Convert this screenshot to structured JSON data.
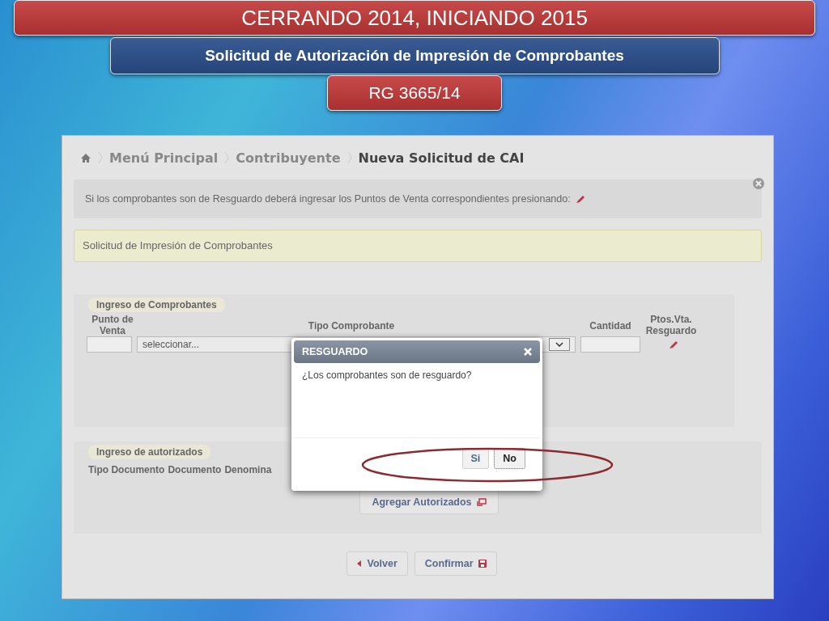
{
  "slide": {
    "title": "CERRANDO 2014, INICIANDO 2015",
    "subtitle": "Solicitud de Autorización de Impresión de Comprobantes",
    "tag": "RG 3665/14"
  },
  "breadcrumb": [
    {
      "label": "Menú Principal",
      "current": false
    },
    {
      "label": "Contribuyente",
      "current": false
    },
    {
      "label": "Nueva Solicitud de CAI",
      "current": true
    }
  ],
  "notice": {
    "text": "Si los comprobantes son de Resguardo deberá ingresar los Puntos de Venta correspondientes presionando:"
  },
  "section_title": "Solicitud de Impresión de Comprobantes",
  "comprobantes": {
    "legend": "Ingreso de Comprobantes",
    "columns": [
      {
        "label": "Punto de Venta"
      },
      {
        "label": "Tipo Comprobante"
      },
      {
        "label": "Cantidad"
      },
      {
        "label": "Ptos.Vta. Resguardo"
      }
    ],
    "select_value": "seleccionar..."
  },
  "autorizados": {
    "legend": "Ingreso de autorizados",
    "columns": [
      "Tipo Documento",
      "Documento",
      "Denomina"
    ],
    "add_button": "Agregar Autorizados"
  },
  "actions": [
    {
      "label": "Volver",
      "kind": "back"
    },
    {
      "label": "Confirmar",
      "kind": "save"
    }
  ],
  "dialog": {
    "title": "RESGUARDO",
    "message": "¿Los comprobantes son de resguardo?",
    "buttons": [
      {
        "label": "Si",
        "focused": false
      },
      {
        "label": "No",
        "focused": true
      }
    ]
  }
}
